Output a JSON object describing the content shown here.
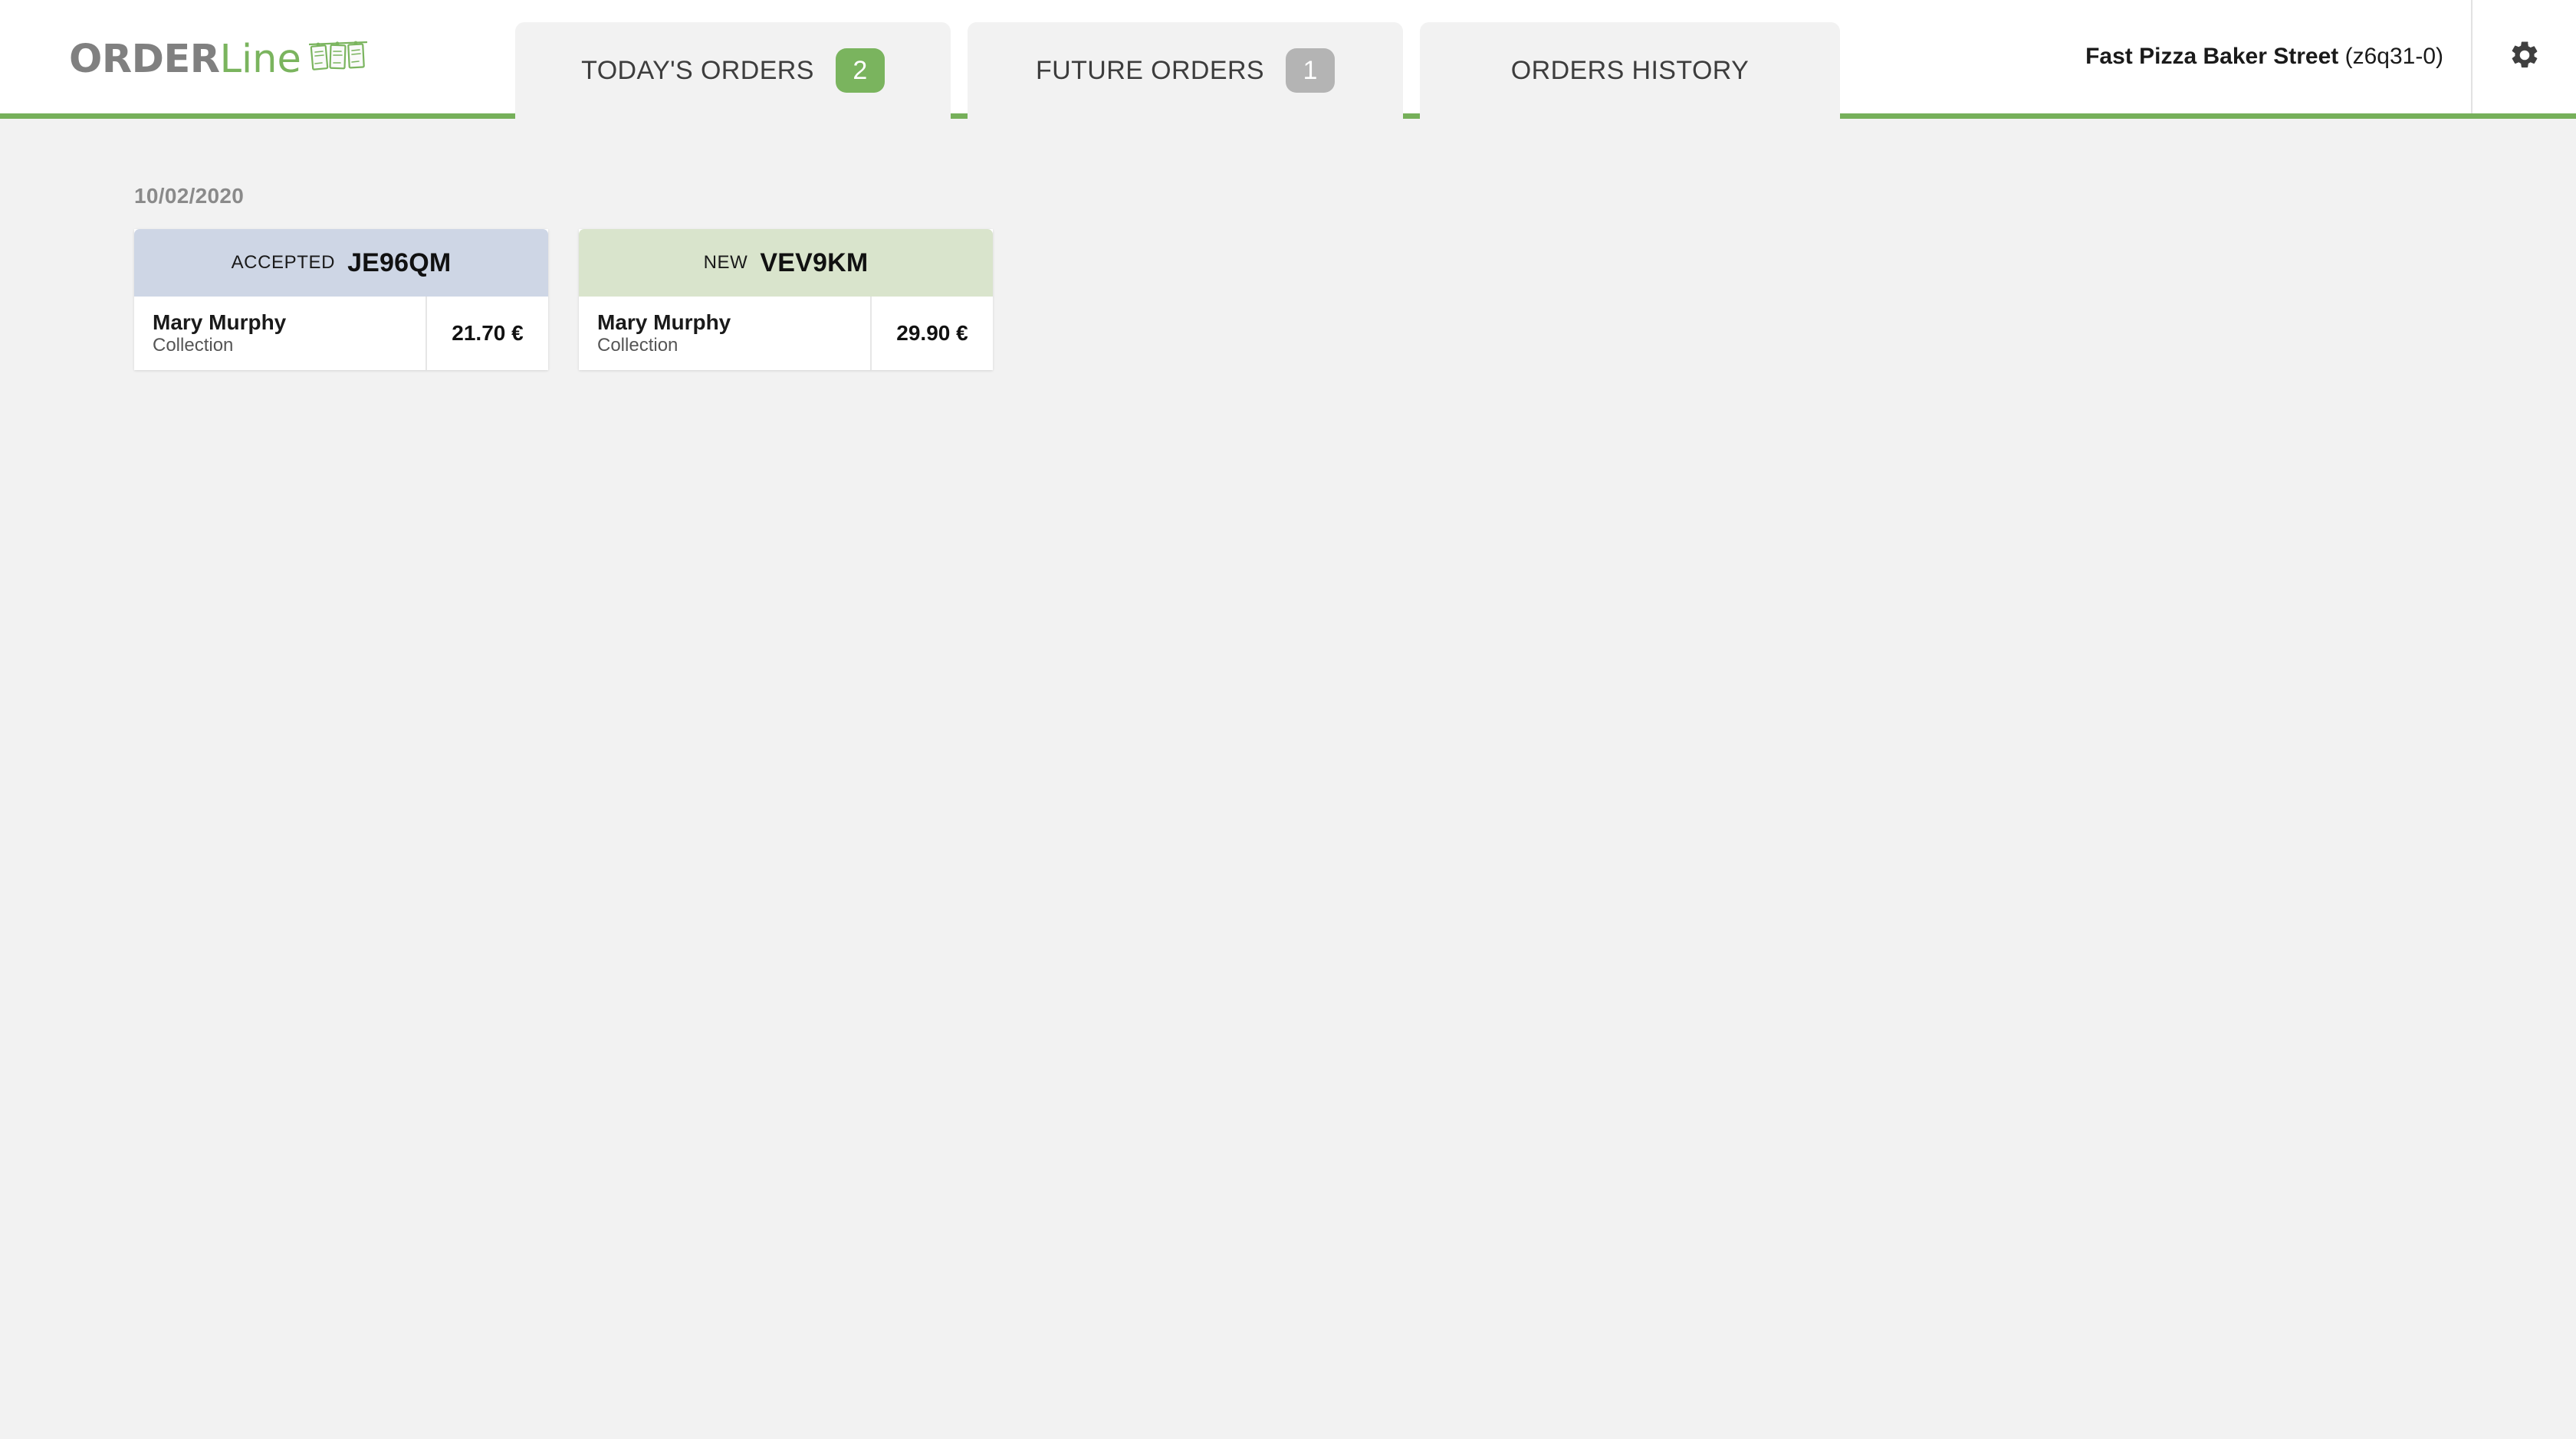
{
  "brand": {
    "word_primary": "ORDER",
    "word_secondary": "Line",
    "logo_icon": "hanging-order-slips-icon"
  },
  "header": {
    "store_name": "Fast Pizza Baker Street",
    "store_code": "(z6q31-0)",
    "settings_icon": "gear-icon"
  },
  "tabs": [
    {
      "label": "TODAY'S ORDERS",
      "badge": "2",
      "badge_style": "green",
      "active": false
    },
    {
      "label": "FUTURE ORDERS",
      "badge": "1",
      "badge_style": "grey",
      "active": true
    },
    {
      "label": "ORDERS HISTORY",
      "badge": null,
      "badge_style": null,
      "active": false
    }
  ],
  "main": {
    "date_heading": "10/02/2020",
    "orders": [
      {
        "status": "ACCEPTED",
        "code": "JE96QM",
        "customer": "Mary Murphy",
        "method": "Collection",
        "price": "21.70 €",
        "header_color": "#ced6e5"
      },
      {
        "status": "NEW",
        "code": "VEV9KM",
        "customer": "Mary Murphy",
        "method": "Collection",
        "price": "29.90 €",
        "header_color": "#d9e4cc"
      }
    ]
  },
  "colors": {
    "accent_green": "#76b05a",
    "badge_green": "#7ab45e",
    "badge_grey": "#b4b4b4",
    "page_background": "#f2f2f2",
    "brand_grey": "#808080"
  }
}
